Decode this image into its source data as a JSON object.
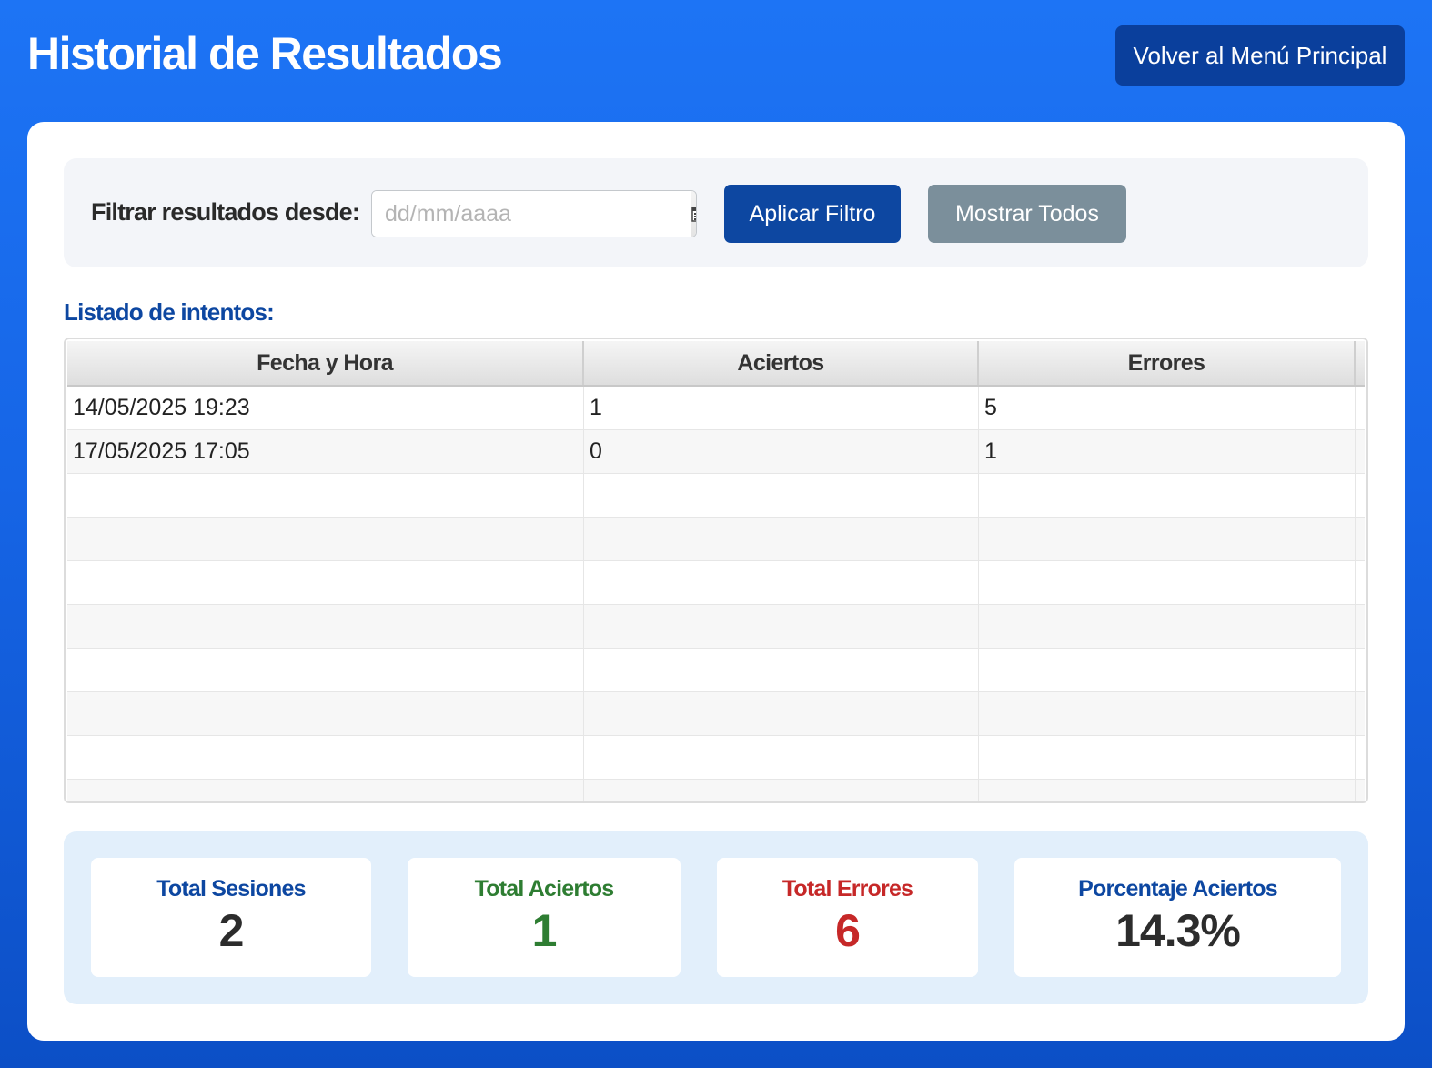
{
  "header": {
    "title": "Historial de Resultados",
    "back_button": "Volver al Menú Principal"
  },
  "filter": {
    "label": "Filtrar resultados desde:",
    "date_placeholder": "dd/mm/aaaa",
    "date_value": "",
    "calendar_icon": "calendar-icon",
    "apply_button": "Aplicar Filtro",
    "show_all_button": "Mostrar Todos"
  },
  "list": {
    "heading": "Listado de intentos:",
    "columns": [
      "Fecha y Hora",
      "Aciertos",
      "Errores"
    ],
    "rows": [
      [
        "14/05/2025 19:23",
        "1",
        "5"
      ],
      [
        "17/05/2025 17:05",
        "0",
        "1"
      ]
    ]
  },
  "stats": [
    {
      "label": "Total Sesiones",
      "value": "2",
      "label_color": "#0d47a1",
      "value_color": "#2c2c2c"
    },
    {
      "label": "Total Aciertos",
      "value": "1",
      "label_color": "#2e7d32",
      "value_color": "#2e7d32"
    },
    {
      "label": "Total Errores",
      "value": "6",
      "label_color": "#c62828",
      "value_color": "#c62828"
    },
    {
      "label": "Porcentaje Aciertos",
      "value": "14.3%",
      "label_color": "#0d47a1",
      "value_color": "#2c2c2c"
    }
  ],
  "colors": {
    "primary": "#0d47a1",
    "secondary_button": "#7b8f9b",
    "background_top": "#1d74f5",
    "background_bottom": "#0c4fc6"
  }
}
